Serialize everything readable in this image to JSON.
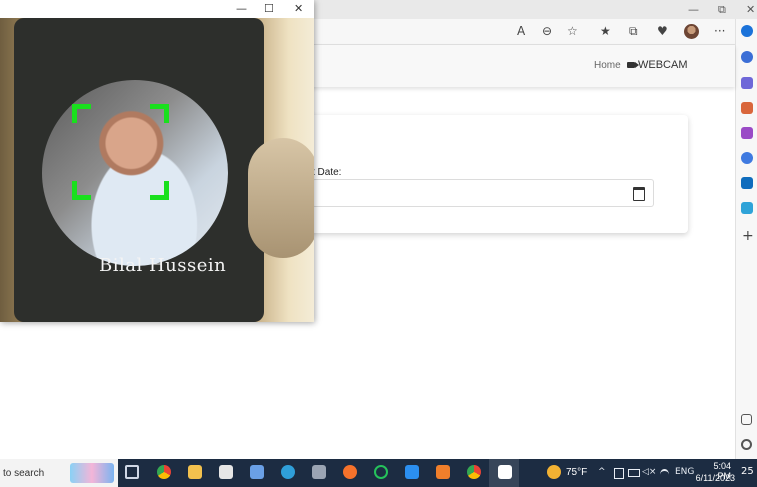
{
  "browser": {
    "window_controls": {
      "minimize": "—",
      "restore": "⧉",
      "close": "✕"
    },
    "toolbar_icons": [
      "read-aloud",
      "zoom-out",
      "favorite-star",
      "favorites",
      "collections",
      "browser-essentials",
      "profile",
      "more"
    ],
    "toolbar_glyphs": {
      "read_aloud": "A",
      "zoom_out": "⊖",
      "favorite": "☆",
      "favorites": "★",
      "collections": "⧉",
      "essentials": "♥",
      "more": "···"
    }
  },
  "site": {
    "nav": {
      "home": "Home",
      "webcam": "WEBCAM"
    },
    "form": {
      "date_label": "t Date:"
    }
  },
  "webcam_window": {
    "controls": {
      "minimize": "—",
      "maximize": "☐",
      "close": "✕"
    },
    "recognized_name": "Bilal Hussein",
    "box_color": "#19e01d"
  },
  "taskbar": {
    "search_text": "to search",
    "weather": "75°F",
    "language": "ENG",
    "time": "5:04 PM",
    "date": "6/11/2023",
    "notifications": "25",
    "tray_glyphs": {
      "chevron": "^",
      "volume": "◁×"
    }
  },
  "sidebar": {
    "add": "+"
  }
}
